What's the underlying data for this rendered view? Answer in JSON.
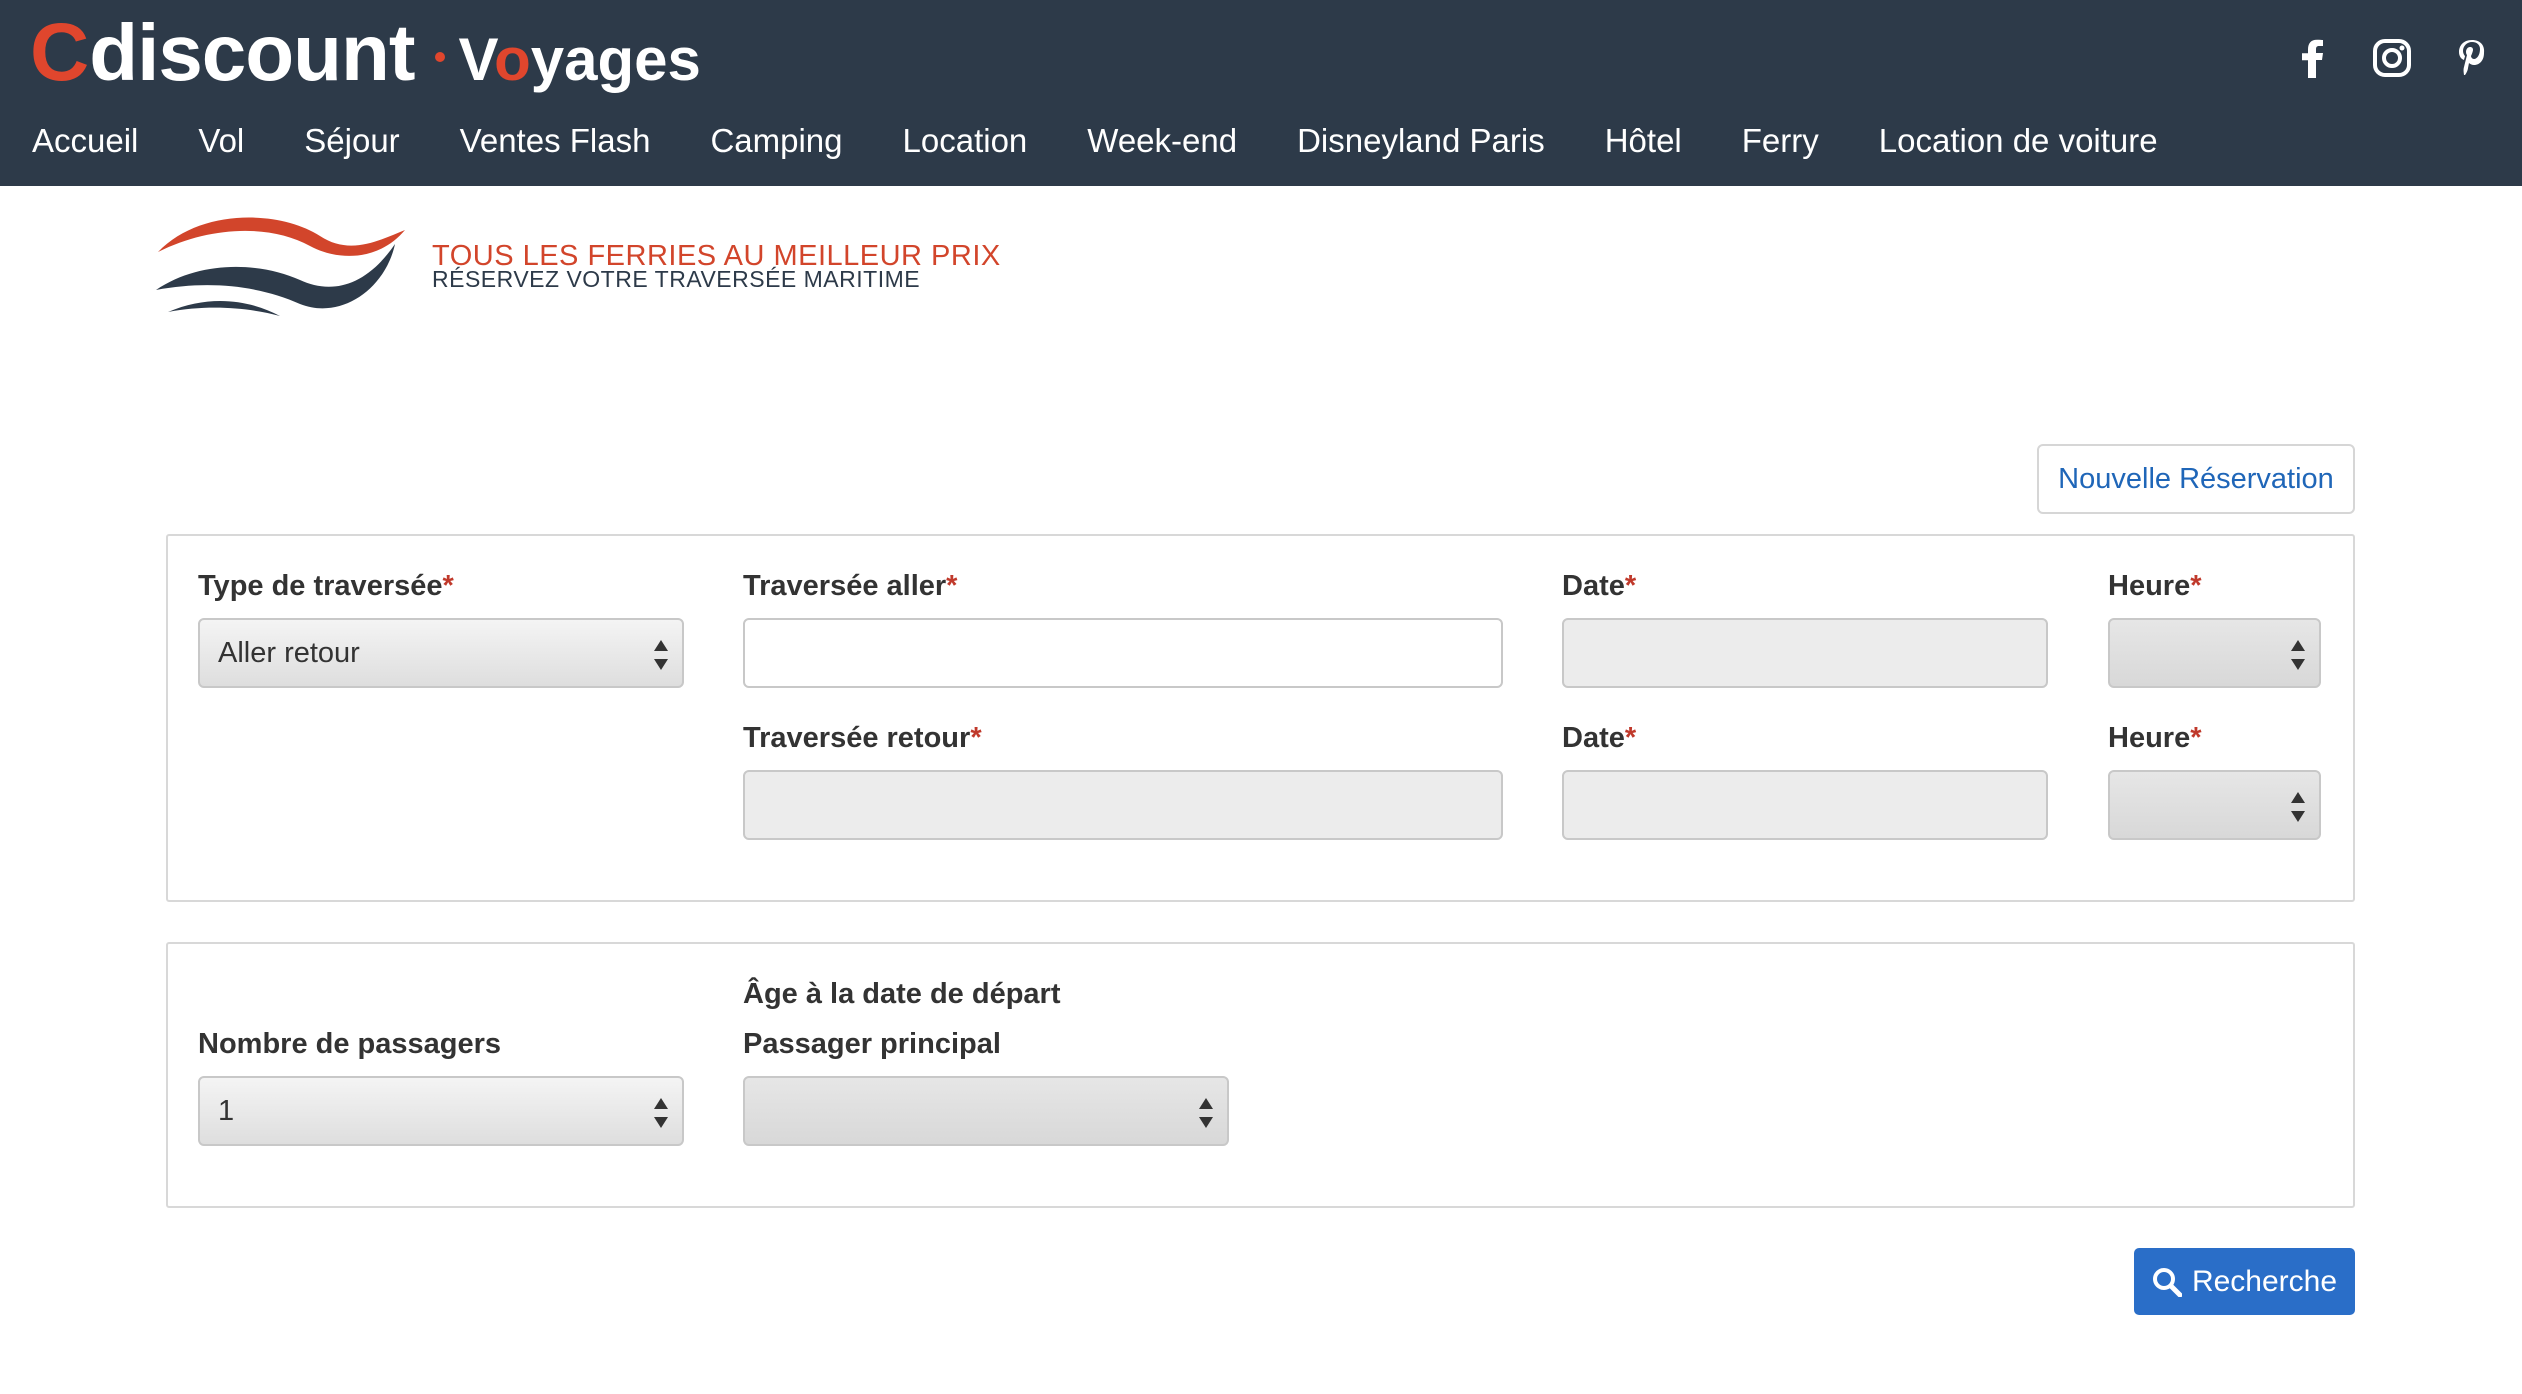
{
  "brand": {
    "logo_c": "C",
    "logo_discount": "discount",
    "logo_voyages_v": "V",
    "logo_voyages_o": "o",
    "logo_voyages_rest": "yages",
    "accent_color": "#e0462d",
    "header_color": "#2d3a49"
  },
  "social": {
    "icons": [
      "facebook-icon",
      "instagram-icon",
      "pinterest-icon"
    ]
  },
  "nav": {
    "items": [
      "Accueil",
      "Vol",
      "Séjour",
      "Ventes Flash",
      "Camping",
      "Location",
      "Week-end",
      "Disneyland Paris",
      "Hôtel",
      "Ferry",
      "Location de voiture"
    ]
  },
  "banner": {
    "headline": "TOUS LES FERRIES AU MEILLEUR PRIX",
    "subline": "RÉSERVEZ VOTRE TRAVERSÉE MARITIME"
  },
  "actions": {
    "new_reservation": "Nouvelle Réservation",
    "search": "Recherche"
  },
  "crossing": {
    "type_label": "Type de traversée",
    "type_value": "Aller retour",
    "outbound_label": "Traversée aller",
    "outbound_value": "",
    "return_label": "Traversée retour",
    "return_value": "",
    "date_label": "Date",
    "time_label": "Heure",
    "required_mark": "*"
  },
  "passengers": {
    "count_label": "Nombre de passagers",
    "count_value": "1",
    "age_heading": "Âge à la date de départ",
    "main_label": "Passager principal",
    "main_value": ""
  }
}
